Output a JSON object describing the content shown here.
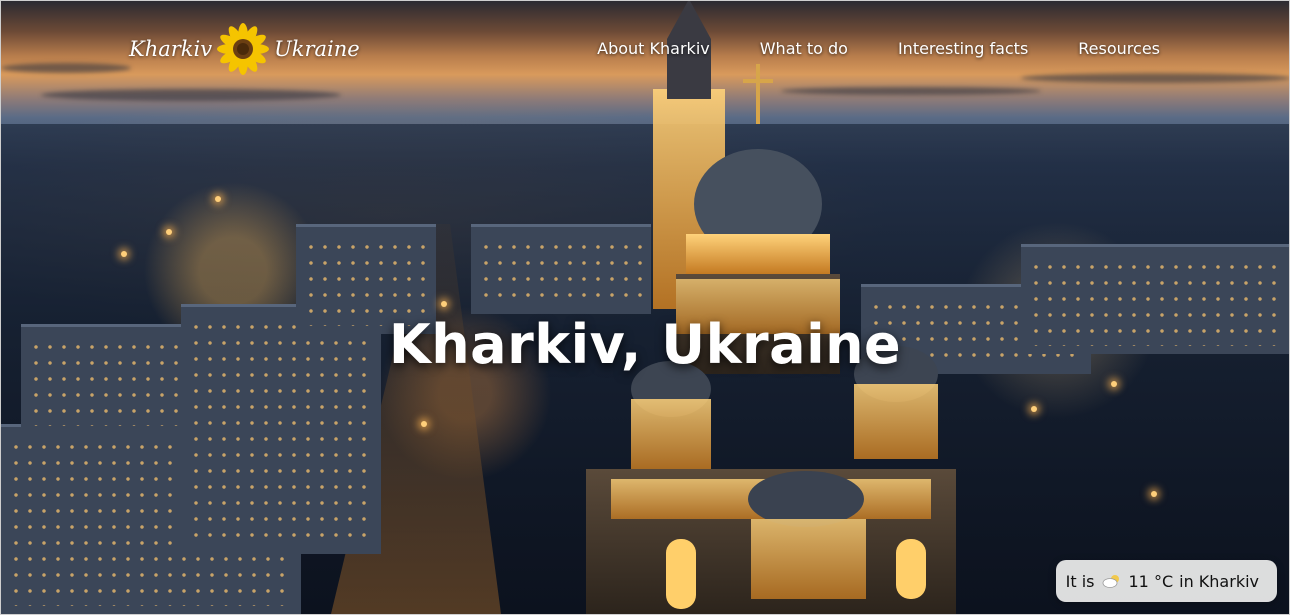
{
  "header": {
    "logo": {
      "left_text": "Kharkiv",
      "icon": "sunflower-icon",
      "right_text": "Ukraine"
    },
    "nav": [
      {
        "label": "About Kharkiv"
      },
      {
        "label": "What to do"
      },
      {
        "label": "Interesting facts"
      },
      {
        "label": "Resources"
      }
    ]
  },
  "hero": {
    "title": "Kharkiv, Ukraine",
    "background_image": "kharkiv-night-cityscape-cathedral"
  },
  "weather": {
    "prefix": "It is",
    "icon": "partly-cloudy-icon",
    "temperature": "11 °C",
    "suffix": "in Kharkiv"
  },
  "colors": {
    "text": "#ffffff",
    "badge_bg": "#e8e8e8",
    "badge_text": "#111111",
    "sunflower_petal": "#f5c400",
    "sunflower_center": "#6b3f12"
  }
}
